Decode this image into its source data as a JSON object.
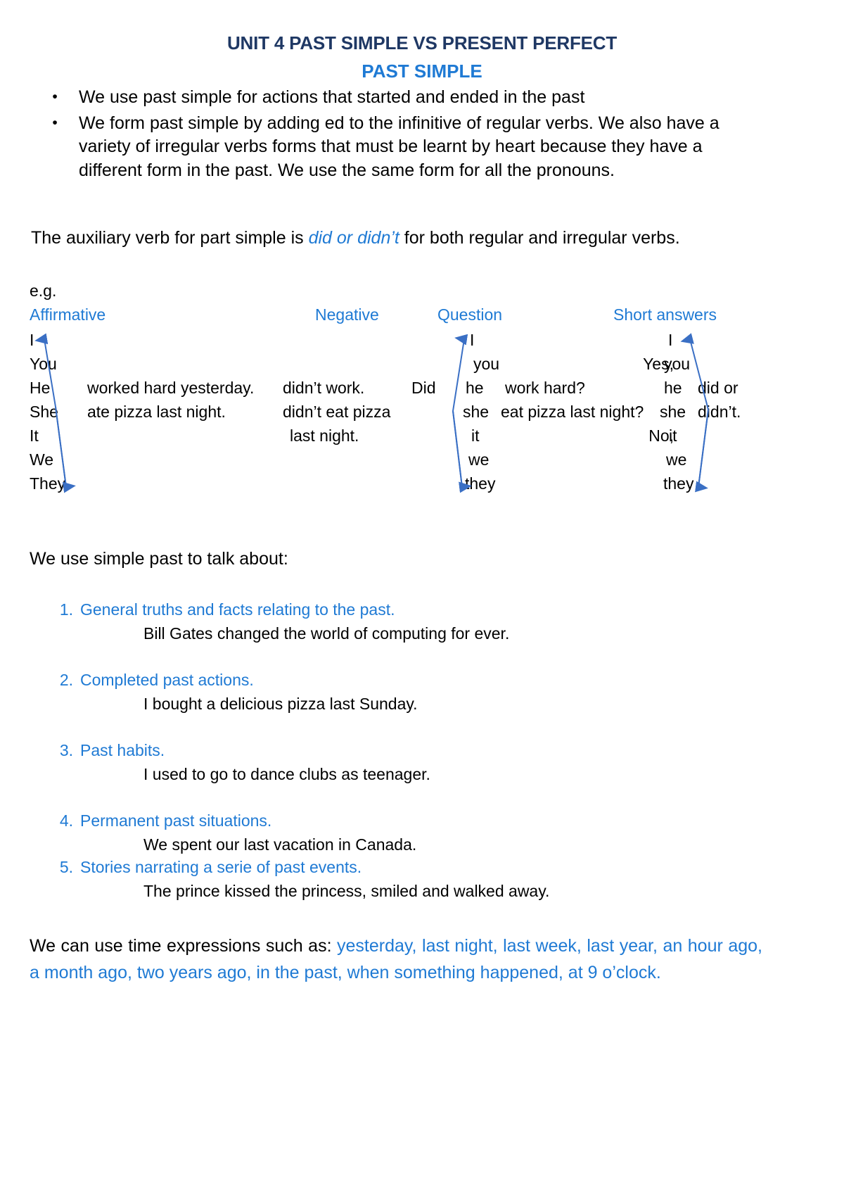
{
  "document": {
    "title_main": "UNIT 4 PAST SIMPLE VS PRESENT PERFECT",
    "title_sub": "PAST SIMPLE",
    "colors": {
      "heading_navy": "#1f3864",
      "accent_blue": "#1f7ad4",
      "body_black": "#000000",
      "arrow_blue": "#3a6fc4"
    }
  },
  "intro": {
    "bullets": [
      "We use past simple for actions that started and ended in the past",
      "We form past simple by adding ed to the infinitive of regular verbs. We also have a variety of irregular verbs forms that must be learnt by heart because they have a different form in the past. We use the same form for all the pronouns."
    ],
    "bullet_glyph": "•"
  },
  "auxiliary": {
    "before": "The auxiliary verb for part simple is ",
    "emphasis": "did or didn’t",
    "after": " for both regular and irregular verbs."
  },
  "example_label": "e.g.",
  "table": {
    "headers": {
      "affirmative": "Affirmative",
      "negative": "Negative",
      "question": "Question",
      "short_answers": "Short answers"
    },
    "pronouns_affirmative": [
      "I",
      "You",
      "He",
      "She",
      "It",
      "We",
      "They"
    ],
    "affirmative_verbs": [
      {
        "row": 2,
        "text": "worked hard yesterday."
      },
      {
        "row": 3,
        "text": "ate pizza last night."
      }
    ],
    "negative_lines": [
      {
        "row": 2,
        "text": "didn’t work."
      },
      {
        "row": 3,
        "text": "didn’t eat pizza"
      },
      {
        "row": 4,
        "text": "last night."
      }
    ],
    "question_auxiliary": {
      "row": 2,
      "text": "Did"
    },
    "pronouns_question": [
      "I",
      "you",
      "he",
      "she",
      "it",
      "we",
      "they"
    ],
    "question_verbs": [
      {
        "row": 2,
        "text": "work hard?"
      },
      {
        "row": 3,
        "text": "eat pizza last night?"
      }
    ],
    "short_answer_leads": [
      {
        "row": 1,
        "text": "Yes,"
      },
      {
        "row": 4,
        "text": "No,"
      }
    ],
    "pronouns_short": [
      "I",
      "you",
      "he",
      "she",
      "it",
      "we",
      "they"
    ],
    "short_answer_aux": [
      {
        "row": 2,
        "text": "did or"
      },
      {
        "row": 3,
        "text": "didn’t."
      }
    ]
  },
  "usage": {
    "lead": "We use simple past to talk about:",
    "items": [
      {
        "number": "1.",
        "label": "General truths and facts relating to the past.",
        "example": "Bill Gates changed the world of computing for ever.",
        "spacing": "large"
      },
      {
        "number": "2.",
        "label": "Completed past actions.",
        "example": "I bought a delicious pizza last Sunday.",
        "spacing": "large"
      },
      {
        "number": "3.",
        "label": "Past habits.",
        "example": "I used to go to dance clubs as teenager.",
        "spacing": "large"
      },
      {
        "number": "4.",
        "label": "Permanent past situations.",
        "example": "We spent our last vacation in Canada.",
        "spacing": "large"
      },
      {
        "number": "5.",
        "label": "Stories narrating a serie of past events.",
        "example": "The prince kissed the princess, smiled and walked away.",
        "spacing": "small"
      }
    ]
  },
  "closing": {
    "before": "We can use time expressions such as: ",
    "expressions": "yesterday, last night, last week, last year, an hour ago, a month ago, two years ago, in the past, when something happened, at 9 o’clock."
  }
}
